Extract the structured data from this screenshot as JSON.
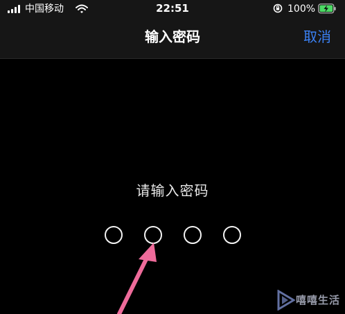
{
  "status_bar": {
    "carrier": "中国移动",
    "time": "22:51",
    "battery_percent": "100%",
    "icons": [
      "signal-icon",
      "wifi-icon",
      "orientation-lock-icon",
      "battery-charging-icon"
    ]
  },
  "nav": {
    "title": "输入密码",
    "cancel_label": "取消"
  },
  "content": {
    "prompt": "请输入密码",
    "passcode_length": 4,
    "passcode_filled": 0
  },
  "watermark": {
    "text": "嘻嘻生活"
  },
  "colors": {
    "accent": "#3b82f6",
    "background": "#000000",
    "bar_background": "#161616",
    "arrow": "#ee6b9a"
  }
}
